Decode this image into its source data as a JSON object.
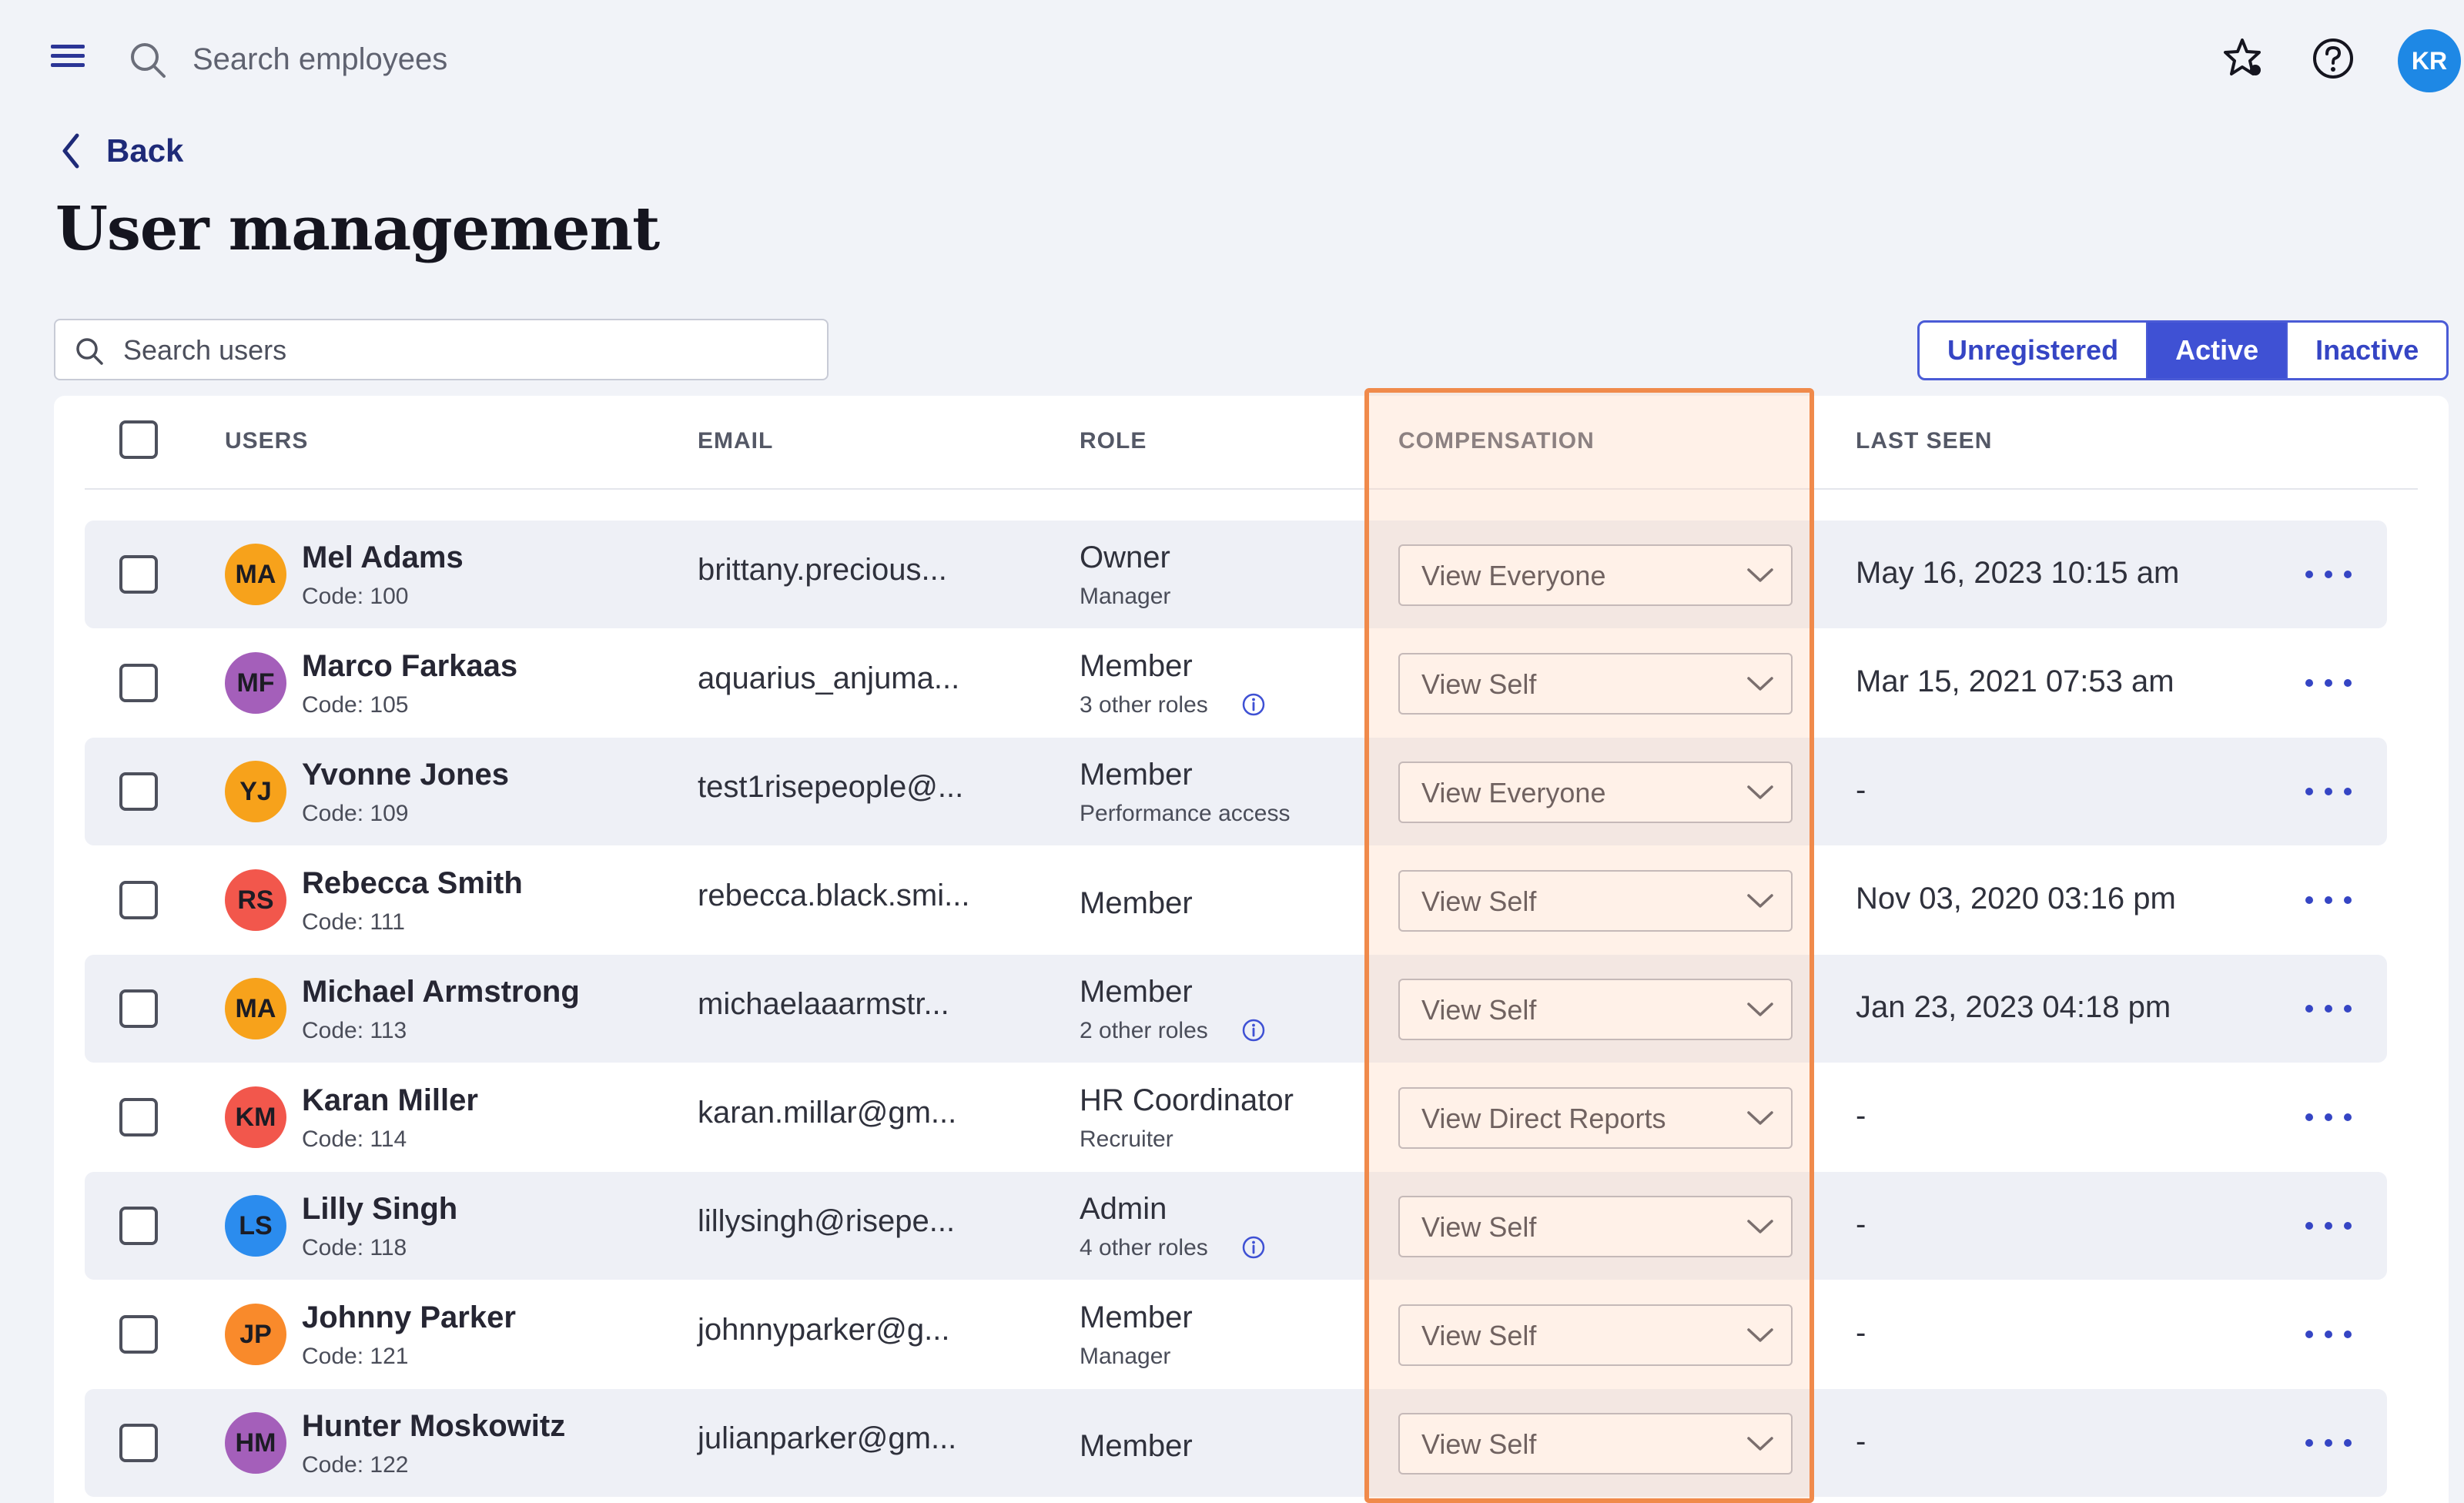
{
  "topbar": {
    "search_placeholder": "Search employees",
    "user_initials": "KR",
    "icons": [
      "menu-icon",
      "search-icon",
      "star-badge-icon",
      "help-icon"
    ]
  },
  "header": {
    "back_label": "Back",
    "title": "User management"
  },
  "filters": {
    "search_placeholder": "Search users",
    "tabs": [
      {
        "label": "Unregistered",
        "active": false
      },
      {
        "label": "Active",
        "active": true
      },
      {
        "label": "Inactive",
        "active": false
      }
    ]
  },
  "table": {
    "columns": {
      "users": "USERS",
      "email": "EMAIL",
      "role": "ROLE",
      "compensation": "COMPENSATION",
      "last_seen": "LAST SEEN"
    },
    "rows": [
      {
        "initials": "MA",
        "avatar_color": "#f7a21b",
        "name": "Mel Adams",
        "code": "Code: 100",
        "email": "brittany.precious...",
        "role": "Owner",
        "role_sub": "Manager",
        "role_info": false,
        "compensation": "View Everyone",
        "last_seen": "May 16, 2023 10:15 am"
      },
      {
        "initials": "MF",
        "avatar_color": "#a45fba",
        "name": "Marco Farkaas",
        "code": "Code: 105",
        "email": "aquarius_anjuma...",
        "role": "Member",
        "role_sub": "3 other roles",
        "role_info": true,
        "compensation": "View Self",
        "last_seen": "Mar 15, 2021 07:53 am"
      },
      {
        "initials": "YJ",
        "avatar_color": "#f7a21b",
        "name": "Yvonne Jones",
        "code": "Code: 109",
        "email": "test1risepeople@...",
        "role": "Member",
        "role_sub": "Performance access",
        "role_info": false,
        "compensation": "View Everyone",
        "last_seen": "-"
      },
      {
        "initials": "RS",
        "avatar_color": "#f2574c",
        "name": "Rebecca Smith",
        "code": "Code: 111",
        "email": "rebecca.black.smi...",
        "role": "Member",
        "role_sub": "",
        "role_info": false,
        "compensation": "View Self",
        "last_seen": "Nov 03, 2020 03:16 pm"
      },
      {
        "initials": "MA",
        "avatar_color": "#f7a21b",
        "name": "Michael Armstrong",
        "code": "Code: 113",
        "email": "michaelaaarmstr...",
        "role": "Member",
        "role_sub": "2 other roles",
        "role_info": true,
        "compensation": "View Self",
        "last_seen": "Jan 23, 2023 04:18 pm"
      },
      {
        "initials": "KM",
        "avatar_color": "#f2574c",
        "name": "Karan Miller",
        "code": "Code: 114",
        "email": "karan.millar@gm...",
        "role": "HR Coordinator",
        "role_sub": "Recruiter",
        "role_info": false,
        "compensation": "View Direct Reports",
        "last_seen": "-"
      },
      {
        "initials": "LS",
        "avatar_color": "#2b8cee",
        "name": "Lilly Singh",
        "code": "Code: 118",
        "email": "lillysingh@risepe...",
        "role": "Admin",
        "role_sub": "4 other roles",
        "role_info": true,
        "compensation": "View Self",
        "last_seen": "-"
      },
      {
        "initials": "JP",
        "avatar_color": "#f98a2b",
        "name": "Johnny Parker",
        "code": "Code: 121",
        "email": "johnnyparker@g...",
        "role": "Member",
        "role_sub": "Manager",
        "role_info": false,
        "compensation": "View Self",
        "last_seen": "-"
      },
      {
        "initials": "HM",
        "avatar_color": "#a45fba",
        "name": "Hunter Moskowitz",
        "code": "Code: 122",
        "email": "julianparker@gm...",
        "role": "Member",
        "role_sub": "",
        "role_info": false,
        "compensation": "View Self",
        "last_seen": "-"
      }
    ]
  },
  "colors": {
    "brand": "#3f51d4",
    "highlight_border": "#f08a4b"
  }
}
